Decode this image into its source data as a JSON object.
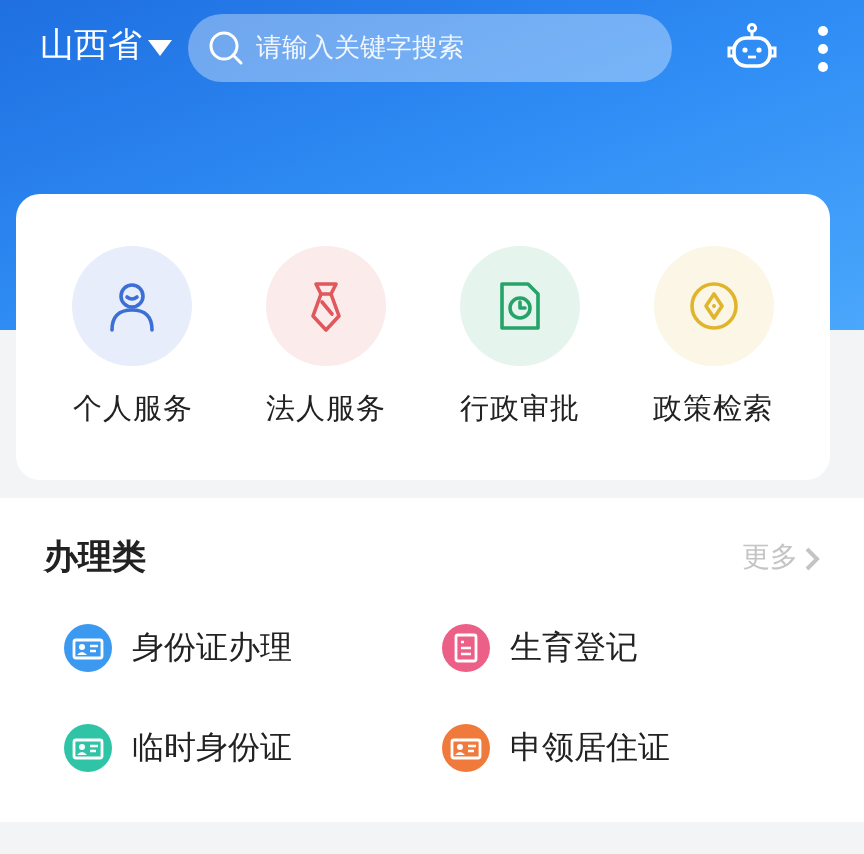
{
  "header": {
    "region": "山西省",
    "search": {
      "placeholder": "请输入关键字搜索"
    }
  },
  "quick_services": [
    {
      "label": "个人服务",
      "kind": "person",
      "color": "#3b6fd6"
    },
    {
      "label": "法人服务",
      "kind": "tie",
      "color": "#e0575c"
    },
    {
      "label": "行政审批",
      "kind": "document",
      "color": "#27a36a"
    },
    {
      "label": "政策检索",
      "kind": "coin",
      "color": "#e0b52c"
    }
  ],
  "section": {
    "title": "办理类",
    "more": "更多",
    "items": [
      {
        "label": "身份证办理",
        "kind": "card",
        "color": "#3b9af0"
      },
      {
        "label": "生育登记",
        "kind": "form",
        "color": "#ec5f86"
      },
      {
        "label": "临时身份证",
        "kind": "card",
        "color": "#2fc4a6"
      },
      {
        "label": "申领居住证",
        "kind": "card",
        "color": "#f07a3c"
      }
    ]
  }
}
